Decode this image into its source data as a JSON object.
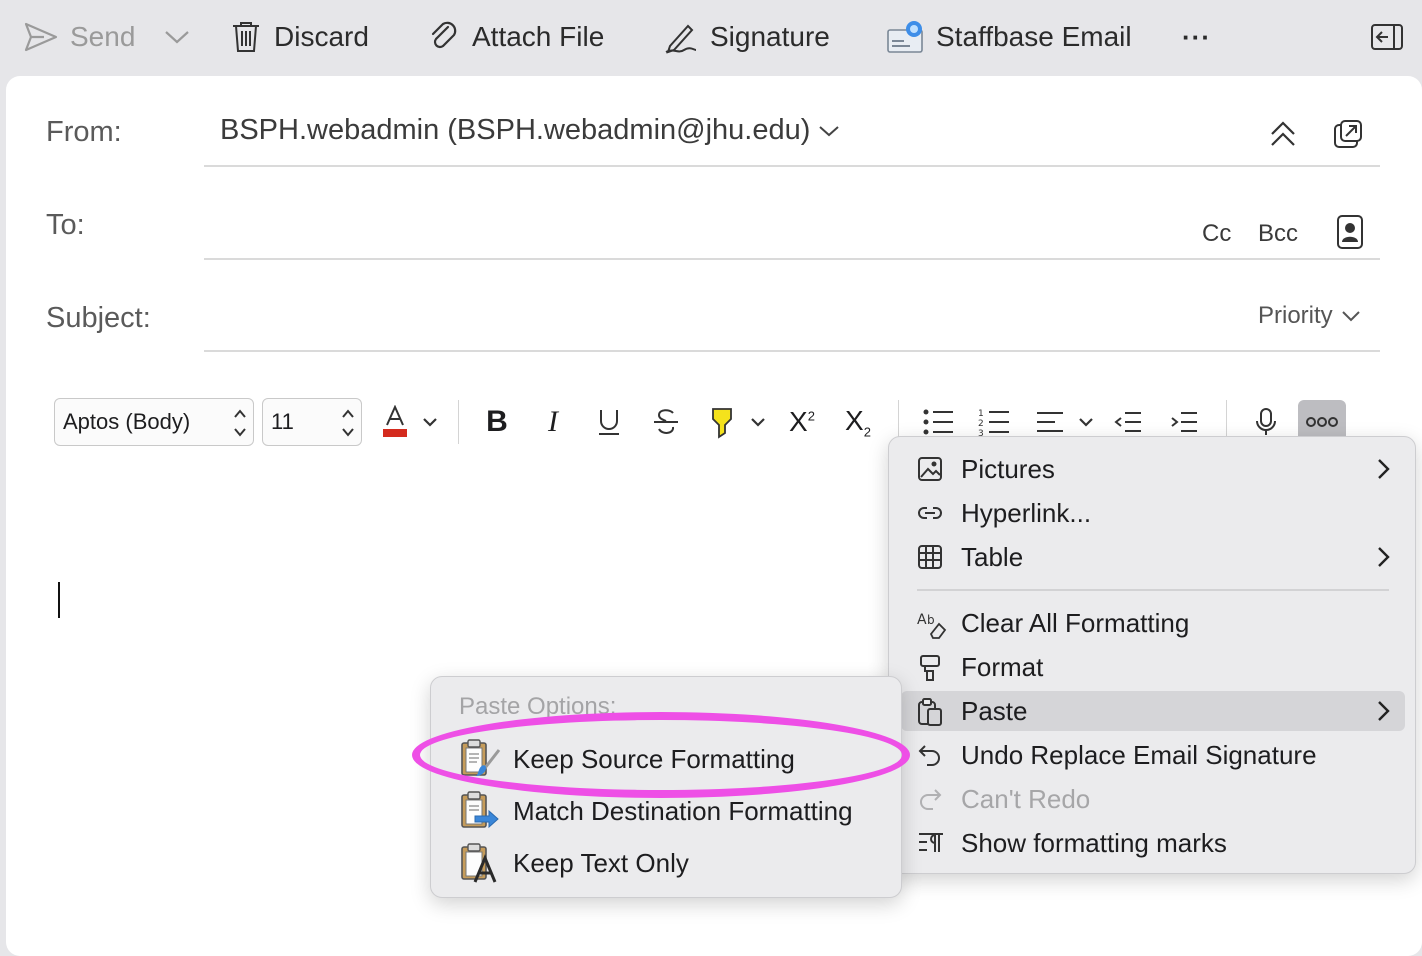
{
  "toolbar": {
    "send_label": "Send",
    "discard_label": "Discard",
    "attach_label": "Attach File",
    "signature_label": "Signature",
    "staffbase_label": "Staffbase Email",
    "more_label": "···"
  },
  "header": {
    "from_label": "From:",
    "from_value": "BSPH.webadmin (BSPH.webadmin@jhu.edu)",
    "to_label": "To:",
    "cc_label": "Cc",
    "bcc_label": "Bcc",
    "subject_label": "Subject:",
    "priority_label": "Priority"
  },
  "format_bar": {
    "font_name": "Aptos (Body)",
    "font_size": "11",
    "superscript_label": "X",
    "subscript_label": "X",
    "sup_mark": "2",
    "sub_mark": "2",
    "font_color": "#d42b1e",
    "highlight_color": "#f4e21c"
  },
  "more_menu": {
    "items": [
      {
        "label": "Pictures",
        "icon": "picture-icon",
        "submenu": true
      },
      {
        "label": "Hyperlink...",
        "icon": "link-icon",
        "submenu": false
      },
      {
        "label": "Table",
        "icon": "table-icon",
        "submenu": true
      },
      {
        "label": "Clear All Formatting",
        "icon": "clear-formatting-icon",
        "submenu": false
      },
      {
        "label": "Format",
        "icon": "format-painter-icon",
        "submenu": false
      },
      {
        "label": "Paste",
        "icon": "paste-icon",
        "submenu": true,
        "highlighted": true
      },
      {
        "label": "Undo Replace Email Signature",
        "icon": "undo-icon",
        "submenu": false
      },
      {
        "label": "Can't Redo",
        "icon": "redo-icon",
        "submenu": false,
        "disabled": true
      },
      {
        "label": "Show formatting marks",
        "icon": "formatting-marks-icon",
        "submenu": false
      }
    ]
  },
  "paste_menu": {
    "header": "Paste Options:",
    "items": [
      {
        "label": "Keep Source Formatting",
        "icon": "keep-source-formatting-icon"
      },
      {
        "label": "Match Destination Formatting",
        "icon": "match-destination-formatting-icon"
      },
      {
        "label": "Keep Text Only",
        "icon": "keep-text-only-icon"
      }
    ]
  },
  "annotation": {
    "color": "#ee4fe6",
    "target": "Keep Source Formatting"
  }
}
